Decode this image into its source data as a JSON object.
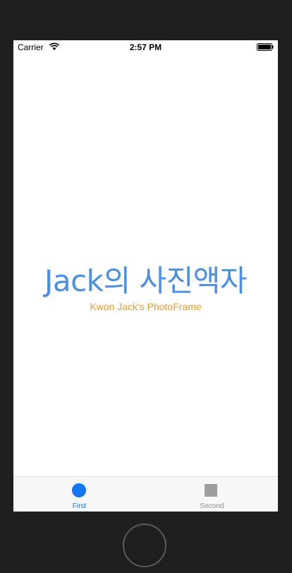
{
  "status_bar": {
    "carrier": "Carrier",
    "time": "2:57 PM",
    "wifi_icon": "wifi-icon",
    "battery_icon": "battery-icon"
  },
  "main": {
    "title": "Jack의 사진액자",
    "subtitle": "Kwon Jack's PhotoFrame"
  },
  "tab_bar": {
    "tabs": [
      {
        "label": "First",
        "icon": "circle-icon",
        "selected": true
      },
      {
        "label": "Second",
        "icon": "square-icon",
        "selected": false
      }
    ]
  },
  "colors": {
    "title": "#4a8fe6",
    "subtitle": "#f39a2b",
    "tab_selected": "#1478f5",
    "tab_unselected": "#8e8e93"
  }
}
